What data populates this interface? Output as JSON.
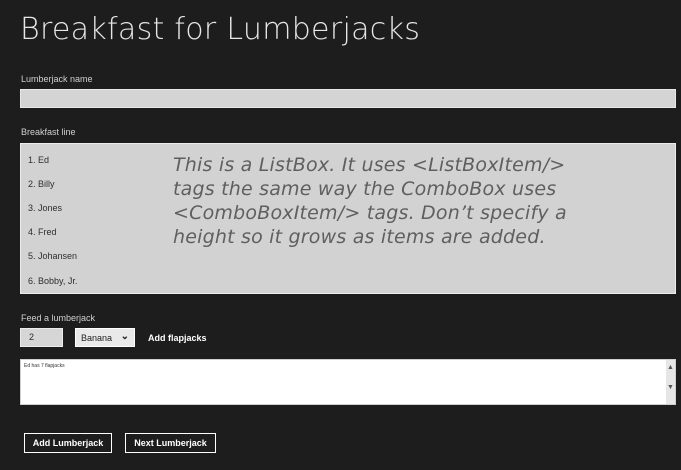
{
  "title": "Breakfast for Lumberjacks",
  "name_section": {
    "label": "Lumberjack name",
    "value": ""
  },
  "breakfast_line": {
    "label": "Breakfast line",
    "items": [
      "1. Ed",
      "2. Billy",
      "3. Jones",
      "4. Fred",
      "5. Johansen",
      "6. Bobby, Jr."
    ]
  },
  "callout": {
    "line1": "This is a ListBox. It uses <ListBoxItem/>",
    "line2": "tags the same way the ComboBox uses",
    "line3": "<ComboBoxItem/> tags. Don’t specify a",
    "line4": "height so it grows as items are added."
  },
  "feed": {
    "label": "Feed a lumberjack",
    "quantity": "2",
    "food": "Banana",
    "add_flapjacks": "Add flapjacks"
  },
  "output": {
    "text": "Ed has 7 flapjacks"
  },
  "buttons": {
    "add_lumberjack": "Add Lumberjack",
    "next_lumberjack": "Next Lumberjack"
  },
  "icons": {
    "combo_arrow": "chevron-down-icon",
    "scroll_up": "scroll-up-icon",
    "scroll_down": "scroll-down-icon"
  },
  "colors": {
    "background": "#1d1d1d",
    "field": "#d2d2d2",
    "callout_text": "#5f5f5f"
  }
}
